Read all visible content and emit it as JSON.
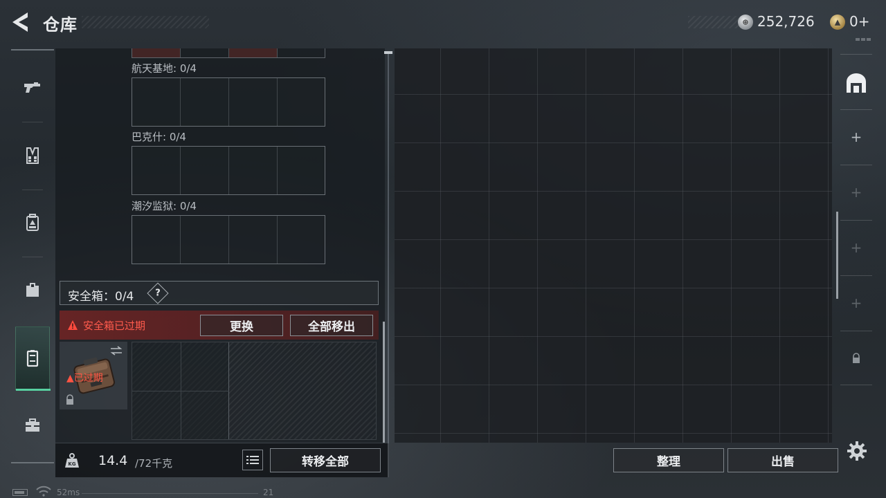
{
  "header": {
    "title": "仓库",
    "silver_amount": "252,726",
    "gold_amount": "0+"
  },
  "nav": {
    "items": [
      {
        "icon": "pistol-icon"
      },
      {
        "icon": "vest-icon"
      },
      {
        "icon": "backpack-icon"
      },
      {
        "icon": "pouch-icon"
      },
      {
        "icon": "safe-case-icon",
        "active": true
      },
      {
        "icon": "briefcase-icon"
      }
    ]
  },
  "storage": {
    "maps": [
      {
        "label": "航天基地: 0/4"
      },
      {
        "label": "巴克什: 0/4"
      },
      {
        "label": "潮汐监狱: 0/4"
      }
    ],
    "safe_title": "安全箱：0/4",
    "help_label": "?",
    "expired_text": "安全箱已过期",
    "replace_label": "更换",
    "move_all_label": "全部移出",
    "case_expired_tag": "已过期"
  },
  "weight": {
    "icon_label": "KG",
    "value": "14.4",
    "capacity": "/72千克",
    "transfer_all_label": "转移全部"
  },
  "warehouse": {
    "organize_label": "整理",
    "sell_label": "出售"
  },
  "status": {
    "ping": "52ms",
    "fps": "21"
  },
  "colors": {
    "accent_green": "#58d0a0",
    "warning_red": "#ff5b4d"
  }
}
